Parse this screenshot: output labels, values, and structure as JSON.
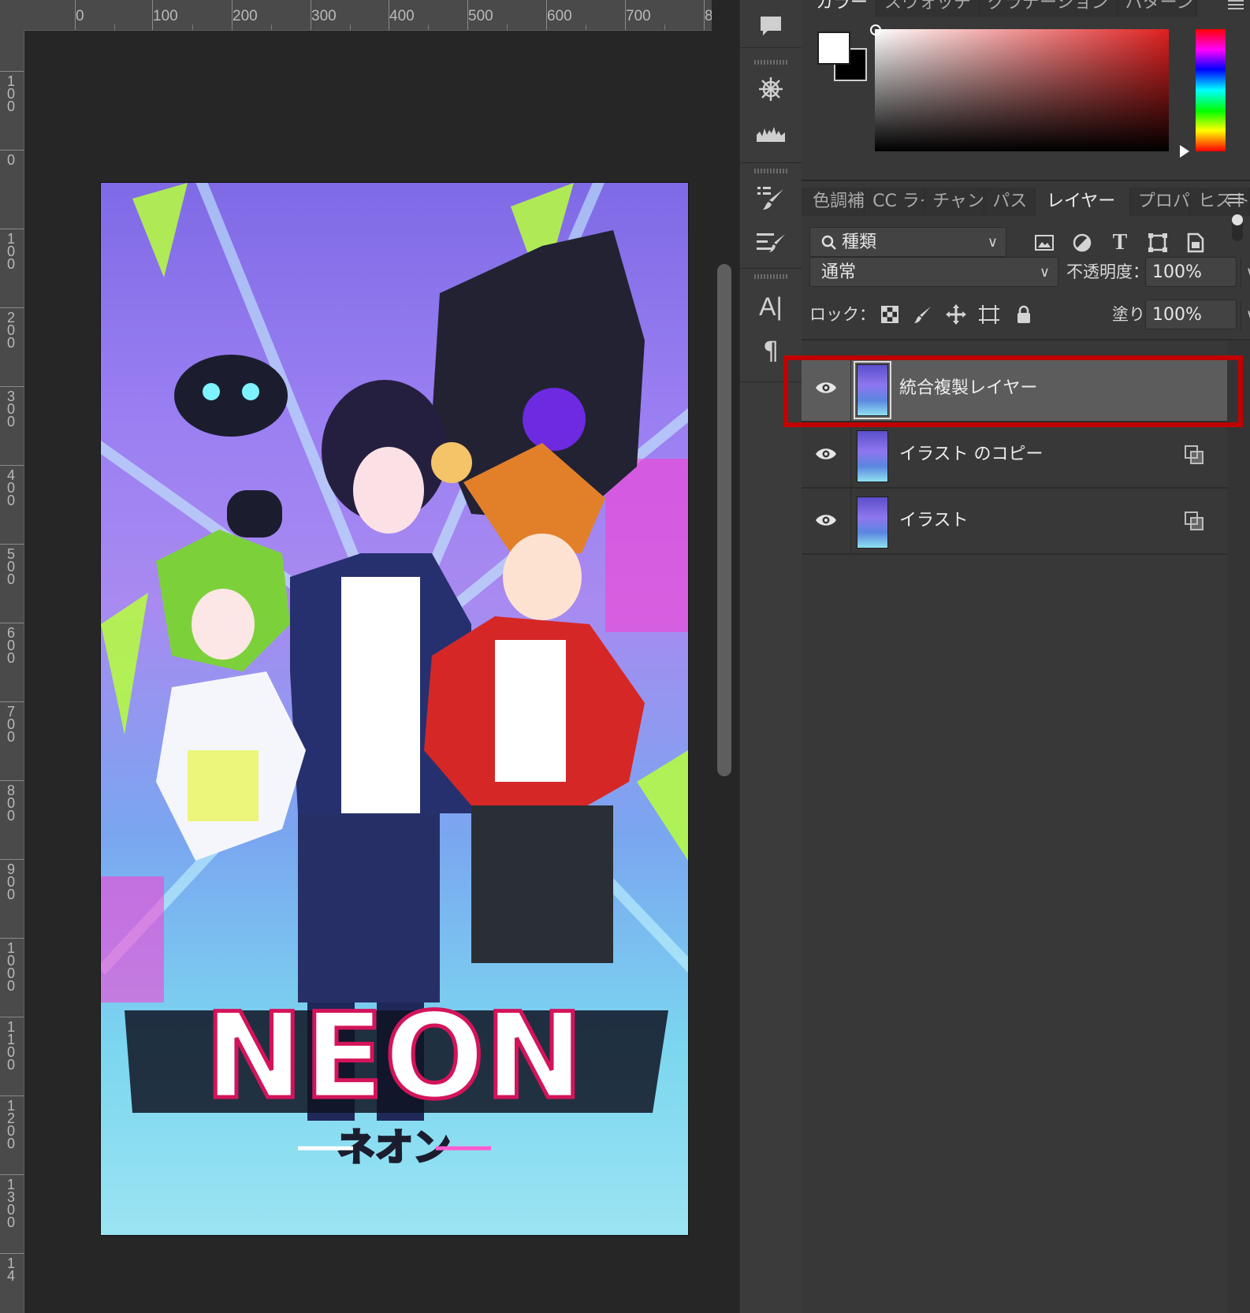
{
  "ruler_top": {
    "labels": [
      "0",
      "100",
      "200",
      "300",
      "400",
      "500",
      "600",
      "700",
      "8"
    ]
  },
  "ruler_left": {
    "labels": [
      "100",
      "0",
      "100",
      "200",
      "300",
      "400",
      "500",
      "600",
      "700",
      "800",
      "900",
      "1000",
      "1100",
      "1200",
      "1300",
      "14"
    ]
  },
  "artwork": {
    "logo_text": "NEON",
    "subtitle_text": "ネオン"
  },
  "color_panel": {
    "tabs": [
      "カラー",
      "スウォッチ",
      "グラデーション",
      "パターン"
    ],
    "foreground": "#ffffff",
    "background": "#000000"
  },
  "layers_panel": {
    "tabs": [
      "色調補正",
      "CC ライブラリ",
      "チャンネル",
      "パス",
      "レイヤー",
      "プロパティ",
      "ヒストリー"
    ],
    "active_tab": "レイヤー",
    "filter_kind": "種類",
    "blend_mode": "通常",
    "opacity_label": "不透明度：",
    "opacity_value": "100%",
    "lock_label": "ロック：",
    "fill_label": "塗り：",
    "fill_value": "100%",
    "layers": [
      {
        "name": "統合複製レイヤー",
        "selected": true
      },
      {
        "name": "イラスト のコピー",
        "selected": false
      },
      {
        "name": "イラスト",
        "selected": false
      }
    ]
  },
  "tools": [
    "comment-icon",
    "3d-axis-icon",
    "histogram-icon",
    "brush-presets-icon",
    "brush-settings-icon",
    "character-icon",
    "paragraph-icon"
  ]
}
